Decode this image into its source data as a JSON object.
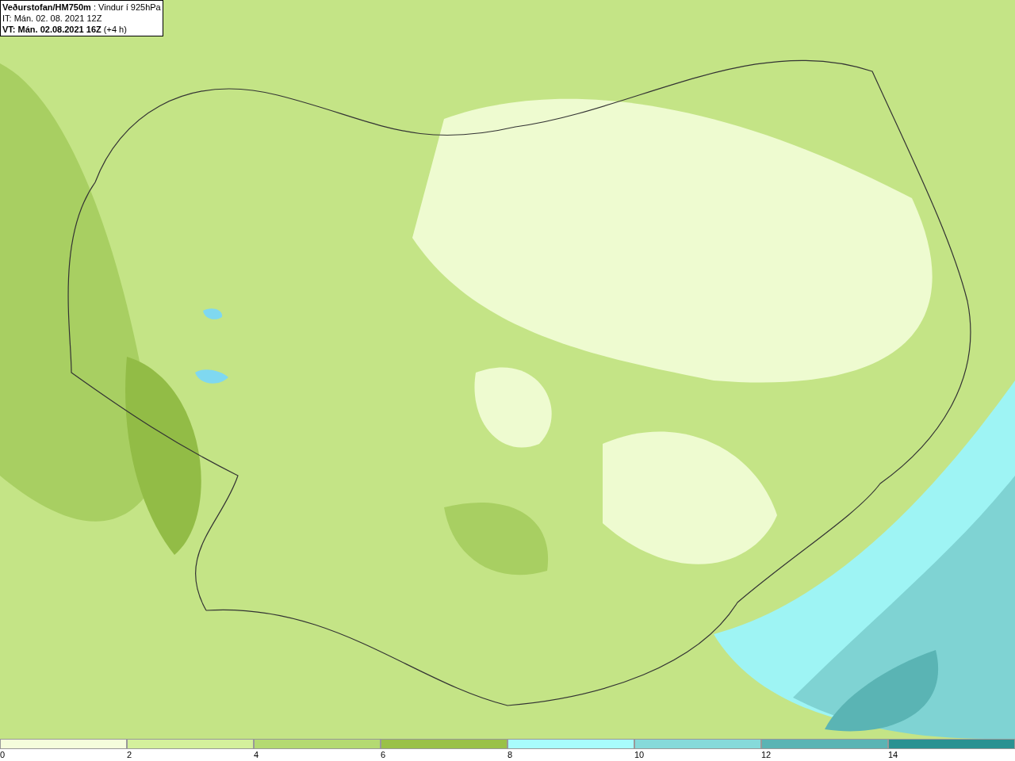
{
  "header": {
    "lines": [
      "**Veðurstofan/HM750m** : Vindur í 925hPa",
      "IT: Mán. 02. 08. 2021 12Z",
      "**VT: Mán. 02.08.2021 16Z** (+4 h)"
    ]
  },
  "legend": [
    {
      "label": "0",
      "color": "#f5fddc"
    },
    {
      "label": "2",
      "color": "#d4f09c"
    },
    {
      "label": "4",
      "color": "#b4da72"
    },
    {
      "label": "6",
      "color": "#9ac148"
    },
    {
      "label": "8",
      "color": "#a8fcfc"
    },
    {
      "label": "10",
      "color": "#86dada"
    },
    {
      "label": "12",
      "color": "#5ab4b4"
    },
    {
      "label": "14",
      "color": "#2a9292"
    }
  ]
}
